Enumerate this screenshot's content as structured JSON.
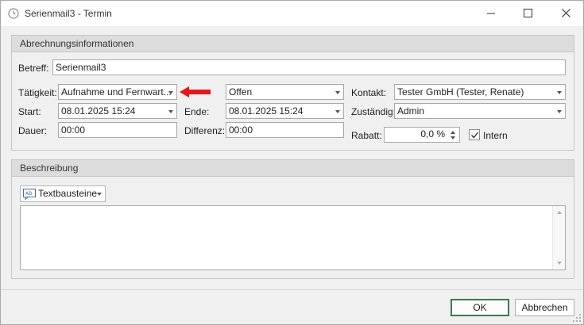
{
  "window": {
    "title": "Serienmail3 - Termin"
  },
  "billing": {
    "header": "Abrechnungsinformationen",
    "subject_label": "Betreff:",
    "subject_value": "Serienmail3",
    "activity_label": "Tätigkeit:",
    "activity_value": "Aufnahme und Fernwart...",
    "status_value": "Offen",
    "contact_label": "Kontakt:",
    "contact_value": "Tester GmbH (Tester, Renate)",
    "start_label": "Start:",
    "start_value": "08.01.2025 15:24",
    "end_label": "Ende:",
    "end_value": "08.01.2025 15:24",
    "responsible_label": "Zuständig:",
    "responsible_value": "Admin",
    "duration_label": "Dauer:",
    "duration_value": "00:00",
    "difference_label": "Differenz:",
    "difference_value": "00:00",
    "discount_label": "Rabatt:",
    "discount_value": "0,0 %",
    "internal_label": "Intern",
    "internal_checked": true
  },
  "description": {
    "header": "Beschreibung",
    "textblocks_label": "Textbausteine",
    "textblocks_icon_text": "AB",
    "text": ""
  },
  "buttons": {
    "ok": "OK",
    "cancel": "Abbrechen"
  },
  "colors": {
    "annotation_arrow": "#e8141b",
    "ok_border": "#3c7a4f"
  }
}
